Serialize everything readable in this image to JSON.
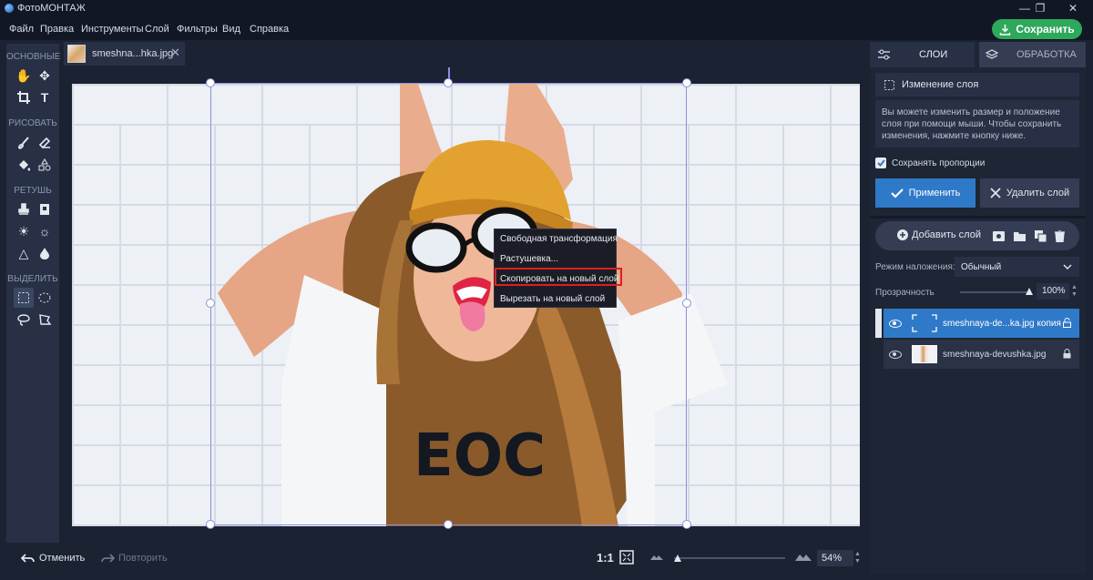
{
  "app": {
    "title": "ФотоМОНТАЖ"
  },
  "menu": [
    "Файл",
    "Правка",
    "Инструменты",
    "Слой",
    "Фильтры",
    "Вид",
    "Справка"
  ],
  "save_button": "Сохранить",
  "tools": {
    "sections": [
      "ОСНОВНЫЕ",
      "РИСОВАТЬ",
      "РЕТУШЬ",
      "ВЫДЕЛИТЬ"
    ]
  },
  "document": {
    "tab_name": "smeshna...hka.jpg"
  },
  "context_menu": {
    "items": [
      "Свободная трансформация",
      "Растушевка...",
      "Скопировать на новый слой",
      "Вырезать на новый слой"
    ],
    "highlighted_index": 2,
    "highlight_color": "#e01e1e"
  },
  "bottom": {
    "undo": "Отменить",
    "redo": "Повторить",
    "ratio": "1:1",
    "zoom": "54%"
  },
  "right_panel": {
    "tabs": [
      "СЛОИ",
      "ОБРАБОТКА"
    ],
    "layer_change_title": "Изменение слоя",
    "info_text": "Вы можете изменить размер и положение слоя при помощи мыши. Чтобы сохранить изменения, нажмите кнопку ниже.",
    "keep_proportions": "Сохранять пропорции",
    "keep_proportions_checked": true,
    "apply": "Применить",
    "delete_layer": "Удалить слой",
    "add_layer": "Добавить слой",
    "blend_mode_label": "Режим наложения:",
    "blend_mode_value": "Обычный",
    "opacity_label": "Прозрачность",
    "opacity_value": "100%",
    "layers": [
      {
        "name": "smeshnaya-de...ka.jpg копия",
        "selected": true
      },
      {
        "name": "smeshnaya-devushka.jpg",
        "selected": false
      }
    ]
  },
  "colors": {
    "accent": "#2f79c9",
    "save_green": "#2ea85a",
    "selection": "#8e8ddc"
  }
}
